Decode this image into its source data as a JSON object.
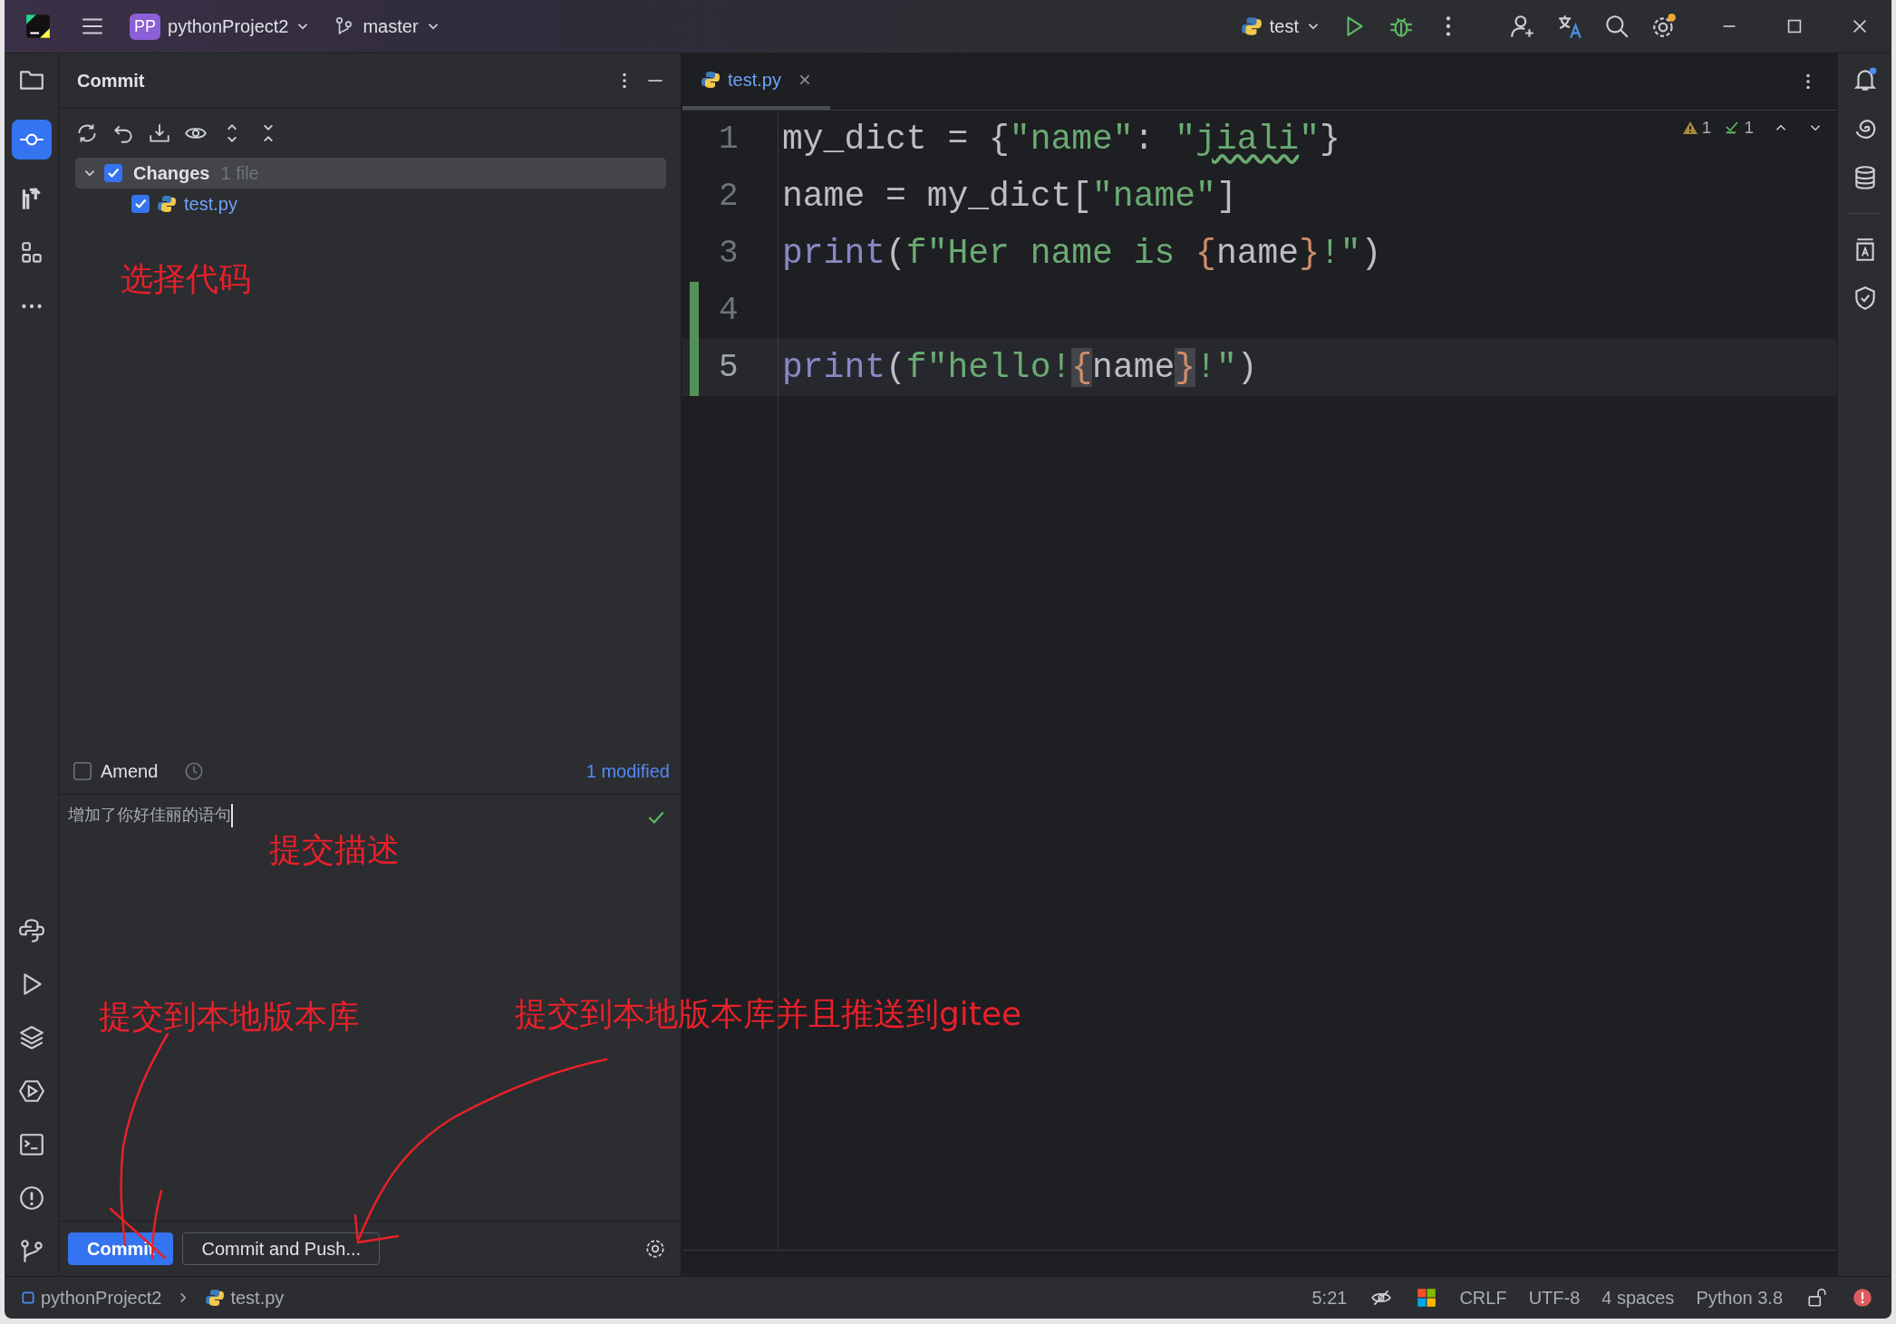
{
  "title_bar": {
    "project_badge": "PP",
    "project": "pythonProject2",
    "branch": "master",
    "run_config": "test"
  },
  "commit_panel": {
    "title": "Commit",
    "tree": [
      {
        "label": "Changes",
        "count": "1 file",
        "checked": true,
        "expanded": true,
        "children": [
          {
            "label": "test.py",
            "checked": true
          }
        ]
      }
    ],
    "amend": {
      "label": "Amend",
      "checked": false
    },
    "modified": "1 modified",
    "message": "增加了你好佳丽的语句",
    "buttons": [
      {
        "label": "Commit",
        "kind": "primary"
      },
      {
        "label": "Commit and Push...",
        "kind": "secondary"
      }
    ]
  },
  "editor": {
    "tabs": [
      {
        "label": "test.py",
        "selected": true
      }
    ],
    "warnings": "1",
    "checks": "1",
    "lines": [
      {
        "number": "1",
        "current": false,
        "changed": false,
        "tokens": [
          {
            "text": "my_dict = {",
            "kind": "plain"
          },
          {
            "text": "\"name\"",
            "kind": "string"
          },
          {
            "text": ": ",
            "kind": "plain"
          },
          {
            "text": "\"",
            "kind": "string"
          },
          {
            "text": "jiali",
            "kind": "typo"
          },
          {
            "text": "\"",
            "kind": "string"
          },
          {
            "text": "}",
            "kind": "plain"
          }
        ]
      },
      {
        "number": "2",
        "current": false,
        "changed": false,
        "tokens": [
          {
            "text": "name = my_dict[",
            "kind": "plain"
          },
          {
            "text": "\"name\"",
            "kind": "string"
          },
          {
            "text": "]",
            "kind": "plain"
          }
        ]
      },
      {
        "number": "3",
        "current": false,
        "changed": false,
        "tokens": [
          {
            "text": "print",
            "kind": "builtin"
          },
          {
            "text": "(",
            "kind": "plain"
          },
          {
            "text": "f\"Her name is ",
            "kind": "string"
          },
          {
            "text": "{",
            "kind": "brace"
          },
          {
            "text": "name",
            "kind": "plain"
          },
          {
            "text": "}",
            "kind": "brace"
          },
          {
            "text": "!\"",
            "kind": "string"
          },
          {
            "text": ")",
            "kind": "plain"
          }
        ]
      },
      {
        "number": "4",
        "current": false,
        "changed": true
      },
      {
        "number": "5",
        "current": true,
        "changed": true,
        "tokens": [
          {
            "text": "print",
            "kind": "builtin"
          },
          {
            "text": "(",
            "kind": "plain"
          },
          {
            "text": "f\"hello!",
            "kind": "string"
          },
          {
            "text": "{",
            "kind": "matched"
          },
          {
            "text": "name",
            "kind": "plain"
          },
          {
            "text": "}",
            "kind": "matched"
          },
          {
            "text": "!\"",
            "kind": "string"
          },
          {
            "text": ")",
            "kind": "plain"
          }
        ]
      }
    ]
  },
  "status_bar": {
    "breadcrumbs": [
      "pythonProject2",
      "test.py"
    ],
    "position": "5:21",
    "items": [
      "CRLF",
      "UTF-8",
      "4 spaces",
      "Python 3.8"
    ]
  },
  "annotations": [
    {
      "text": "选择代码"
    },
    {
      "text": "提交描述"
    },
    {
      "text": "提交到本地版本库"
    },
    {
      "text": "提交到本地版本库并且推送到gitee"
    }
  ]
}
